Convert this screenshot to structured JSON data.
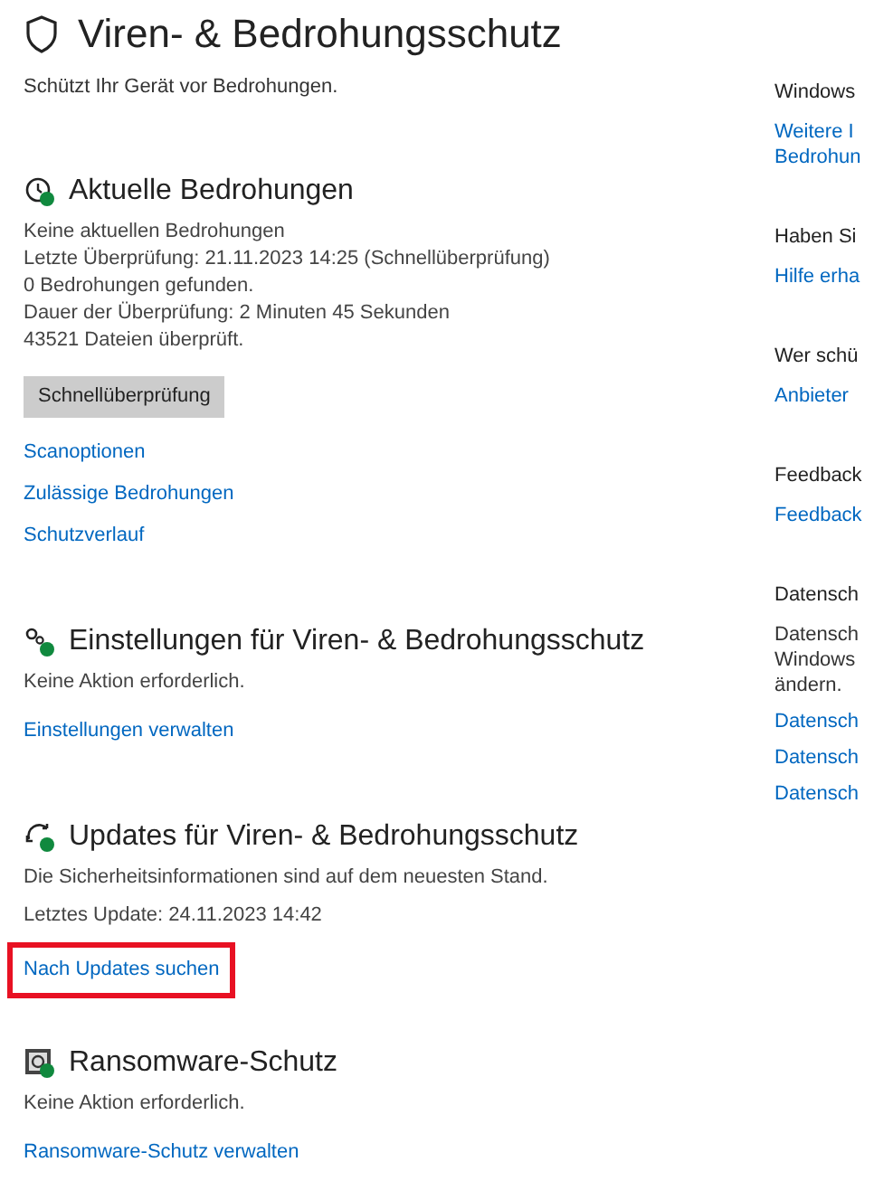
{
  "page": {
    "title": "Viren- & Bedrohungsschutz",
    "subtitle": "Schützt Ihr Gerät vor Bedrohungen."
  },
  "sections": [
    {
      "heading": "Aktuelle Bedrohungen",
      "lines": [
        "Keine aktuellen Bedrohungen",
        "Letzte Überprüfung: 21.11.2023 14:25 (Schnellüberprüfung)",
        "0 Bedrohungen gefunden.",
        "Dauer der Überprüfung: 2 Minuten 45 Sekunden",
        "43521 Dateien überprüft."
      ],
      "button": "Schnellüberprüfung",
      "links": [
        {
          "label": "Scanoptionen",
          "highlighted": false
        },
        {
          "label": "Zulässige Bedrohungen",
          "highlighted": false
        },
        {
          "label": "Schutzverlauf",
          "highlighted": false
        }
      ]
    },
    {
      "heading": "Einstellungen für Viren- & Bedrohungsschutz",
      "lines": [
        "Keine Aktion erforderlich."
      ],
      "links": [
        {
          "label": "Einstellungen verwalten",
          "highlighted": false
        }
      ]
    },
    {
      "heading": "Updates für Viren- & Bedrohungsschutz",
      "lines": [
        "Die Sicherheitsinformationen sind auf dem neuesten Stand.",
        "Letztes Update: 24.11.2023 14:42"
      ],
      "links": [
        {
          "label": "Nach Updates suchen",
          "highlighted": true
        }
      ]
    },
    {
      "heading": "Ransomware-Schutz",
      "lines": [
        "Keine Aktion erforderlich."
      ],
      "links": [
        {
          "label": "Ransomware-Schutz verwalten",
          "highlighted": false
        }
      ]
    }
  ],
  "sidebar": [
    {
      "heading": "Windows",
      "links": [
        "Weitere I",
        "Bedrohun"
      ]
    },
    {
      "heading": "Haben Si",
      "links": [
        "Hilfe erha"
      ]
    },
    {
      "heading": "Wer schü",
      "links": [
        "Anbieter"
      ]
    },
    {
      "heading": "Feedback",
      "links": [
        "Feedback"
      ]
    },
    {
      "heading": "Datensch",
      "text": [
        "Datensch",
        "Windows",
        "ändern."
      ],
      "links": [
        "Datensch",
        "Datensch",
        "Datensch"
      ]
    }
  ]
}
